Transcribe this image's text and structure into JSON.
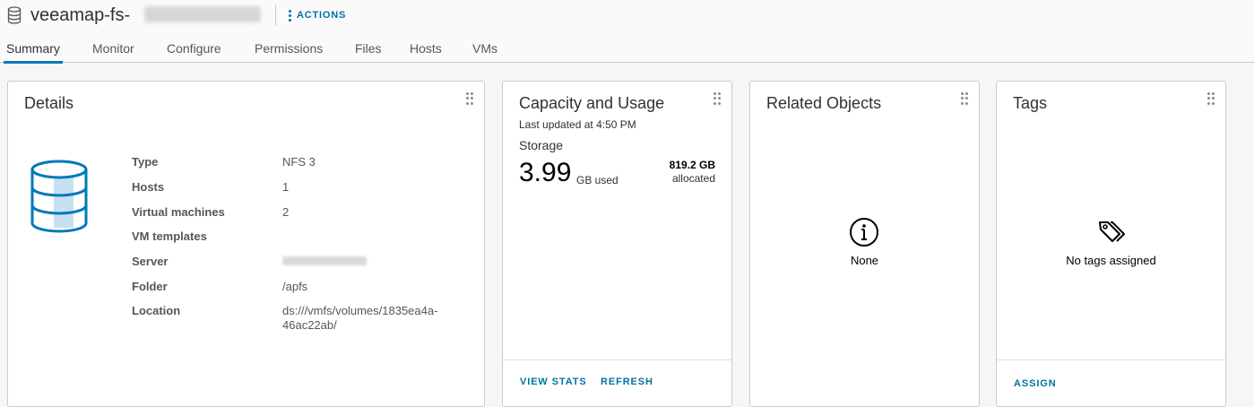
{
  "header": {
    "title": "veeamap-fs-",
    "icon": "datastore-icon",
    "actions_label": "ACTIONS"
  },
  "tabs": [
    {
      "label": "Summary",
      "active": true
    },
    {
      "label": "Monitor"
    },
    {
      "label": "Configure"
    },
    {
      "label": "Permissions"
    },
    {
      "label": "Files"
    },
    {
      "label": "Hosts"
    },
    {
      "label": "VMs"
    }
  ],
  "details": {
    "title": "Details",
    "properties": [
      {
        "label": "Type",
        "value": "NFS 3"
      },
      {
        "label": "Hosts",
        "value": "1"
      },
      {
        "label": "Virtual machines",
        "value": "2"
      },
      {
        "label": "VM templates",
        "value": ""
      },
      {
        "label": "Server",
        "value": ""
      },
      {
        "label": "Folder",
        "value": "/apfs"
      },
      {
        "label": "Location",
        "value": "ds:///vmfs/volumes/1835ea4a-46ac22ab/"
      }
    ]
  },
  "capacity": {
    "title": "Capacity and Usage",
    "last_updated": "Last updated at 4:50 PM",
    "storage_label": "Storage",
    "used_value": "3.99",
    "used_unit": "GB used",
    "allocated_value": "819.2 GB",
    "allocated_label": "allocated",
    "view_stats": "VIEW STATS",
    "refresh": "REFRESH"
  },
  "related": {
    "title": "Related Objects",
    "empty_text": "None"
  },
  "tags": {
    "title": "Tags",
    "empty_text": "No tags assigned",
    "assign": "ASSIGN"
  },
  "colors": {
    "link": "#0072a3",
    "active_tab": "#0079b8",
    "db_stroke": "#0079b8",
    "db_fill": "#c7e1f1"
  }
}
